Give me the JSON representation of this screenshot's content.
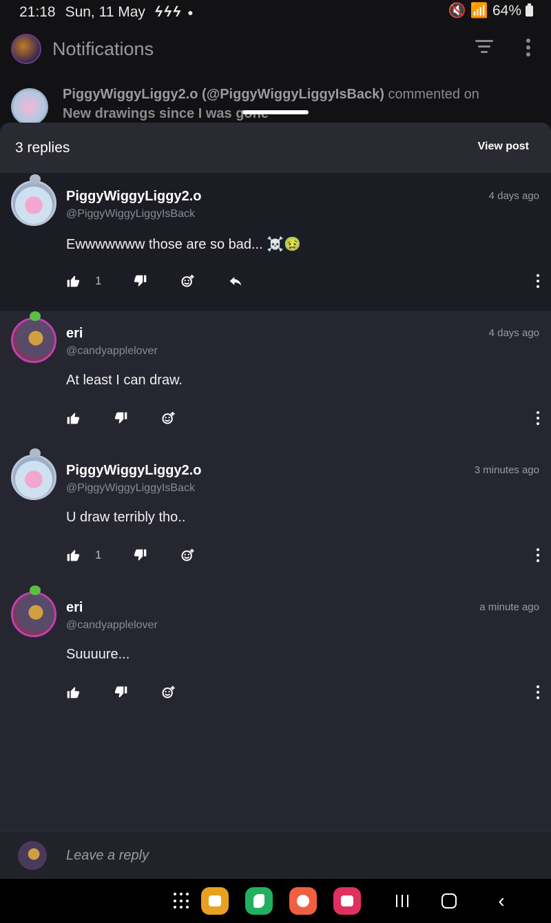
{
  "status_bar": {
    "time": "21:18",
    "date": "Sun, 11 May",
    "flashes": "ϟϟϟ",
    "battery": "64%"
  },
  "app_header": {
    "title": "Notifications"
  },
  "notification": {
    "actor": "PiggyWiggyLiggy2.o (@PiggyWiggyLiggyIsBack)",
    "action": " commented on",
    "post_title": "New drawings since I was gone"
  },
  "sheet": {
    "reply_count": "3 replies",
    "view_post_label": "View post"
  },
  "comments": [
    {
      "name": "PiggyWiggyLiggy2.o",
      "handle": "@PiggyWiggyLiggyIsBack",
      "time": "4 days ago",
      "text": "Ewwwwwww those are so bad... ☠️🤢",
      "likes": "1"
    },
    {
      "name": "eri",
      "handle": "@candyapplelover",
      "time": "4 days ago",
      "text": "At least I can draw.",
      "likes": ""
    },
    {
      "name": "PiggyWiggyLiggy2.o",
      "handle": "@PiggyWiggyLiggyIsBack",
      "time": "3 minutes ago",
      "text": "U draw terribly tho..",
      "likes": "1"
    },
    {
      "name": "eri",
      "handle": "@candyapplelover",
      "time": "a minute ago",
      "text": "Suuuure...",
      "likes": ""
    }
  ],
  "reply_bar": {
    "placeholder": "Leave a reply"
  },
  "colors": {
    "sheet_bg": "#262630",
    "first_comment_bg": "#1c1c24",
    "accent_eri": "#c040b0"
  }
}
